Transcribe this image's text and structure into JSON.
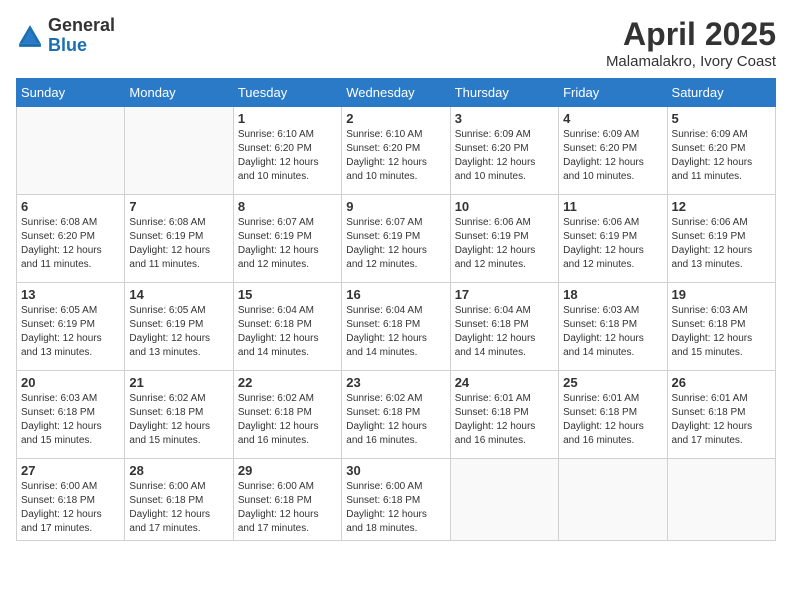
{
  "header": {
    "logo_general": "General",
    "logo_blue": "Blue",
    "month_title": "April 2025",
    "location": "Malamalakro, Ivory Coast"
  },
  "weekdays": [
    "Sunday",
    "Monday",
    "Tuesday",
    "Wednesday",
    "Thursday",
    "Friday",
    "Saturday"
  ],
  "weeks": [
    [
      {
        "day": "",
        "detail": ""
      },
      {
        "day": "",
        "detail": ""
      },
      {
        "day": "1",
        "detail": "Sunrise: 6:10 AM\nSunset: 6:20 PM\nDaylight: 12 hours and 10 minutes."
      },
      {
        "day": "2",
        "detail": "Sunrise: 6:10 AM\nSunset: 6:20 PM\nDaylight: 12 hours and 10 minutes."
      },
      {
        "day": "3",
        "detail": "Sunrise: 6:09 AM\nSunset: 6:20 PM\nDaylight: 12 hours and 10 minutes."
      },
      {
        "day": "4",
        "detail": "Sunrise: 6:09 AM\nSunset: 6:20 PM\nDaylight: 12 hours and 10 minutes."
      },
      {
        "day": "5",
        "detail": "Sunrise: 6:09 AM\nSunset: 6:20 PM\nDaylight: 12 hours and 11 minutes."
      }
    ],
    [
      {
        "day": "6",
        "detail": "Sunrise: 6:08 AM\nSunset: 6:20 PM\nDaylight: 12 hours and 11 minutes."
      },
      {
        "day": "7",
        "detail": "Sunrise: 6:08 AM\nSunset: 6:19 PM\nDaylight: 12 hours and 11 minutes."
      },
      {
        "day": "8",
        "detail": "Sunrise: 6:07 AM\nSunset: 6:19 PM\nDaylight: 12 hours and 12 minutes."
      },
      {
        "day": "9",
        "detail": "Sunrise: 6:07 AM\nSunset: 6:19 PM\nDaylight: 12 hours and 12 minutes."
      },
      {
        "day": "10",
        "detail": "Sunrise: 6:06 AM\nSunset: 6:19 PM\nDaylight: 12 hours and 12 minutes."
      },
      {
        "day": "11",
        "detail": "Sunrise: 6:06 AM\nSunset: 6:19 PM\nDaylight: 12 hours and 12 minutes."
      },
      {
        "day": "12",
        "detail": "Sunrise: 6:06 AM\nSunset: 6:19 PM\nDaylight: 12 hours and 13 minutes."
      }
    ],
    [
      {
        "day": "13",
        "detail": "Sunrise: 6:05 AM\nSunset: 6:19 PM\nDaylight: 12 hours and 13 minutes."
      },
      {
        "day": "14",
        "detail": "Sunrise: 6:05 AM\nSunset: 6:19 PM\nDaylight: 12 hours and 13 minutes."
      },
      {
        "day": "15",
        "detail": "Sunrise: 6:04 AM\nSunset: 6:18 PM\nDaylight: 12 hours and 14 minutes."
      },
      {
        "day": "16",
        "detail": "Sunrise: 6:04 AM\nSunset: 6:18 PM\nDaylight: 12 hours and 14 minutes."
      },
      {
        "day": "17",
        "detail": "Sunrise: 6:04 AM\nSunset: 6:18 PM\nDaylight: 12 hours and 14 minutes."
      },
      {
        "day": "18",
        "detail": "Sunrise: 6:03 AM\nSunset: 6:18 PM\nDaylight: 12 hours and 14 minutes."
      },
      {
        "day": "19",
        "detail": "Sunrise: 6:03 AM\nSunset: 6:18 PM\nDaylight: 12 hours and 15 minutes."
      }
    ],
    [
      {
        "day": "20",
        "detail": "Sunrise: 6:03 AM\nSunset: 6:18 PM\nDaylight: 12 hours and 15 minutes."
      },
      {
        "day": "21",
        "detail": "Sunrise: 6:02 AM\nSunset: 6:18 PM\nDaylight: 12 hours and 15 minutes."
      },
      {
        "day": "22",
        "detail": "Sunrise: 6:02 AM\nSunset: 6:18 PM\nDaylight: 12 hours and 16 minutes."
      },
      {
        "day": "23",
        "detail": "Sunrise: 6:02 AM\nSunset: 6:18 PM\nDaylight: 12 hours and 16 minutes."
      },
      {
        "day": "24",
        "detail": "Sunrise: 6:01 AM\nSunset: 6:18 PM\nDaylight: 12 hours and 16 minutes."
      },
      {
        "day": "25",
        "detail": "Sunrise: 6:01 AM\nSunset: 6:18 PM\nDaylight: 12 hours and 16 minutes."
      },
      {
        "day": "26",
        "detail": "Sunrise: 6:01 AM\nSunset: 6:18 PM\nDaylight: 12 hours and 17 minutes."
      }
    ],
    [
      {
        "day": "27",
        "detail": "Sunrise: 6:00 AM\nSunset: 6:18 PM\nDaylight: 12 hours and 17 minutes."
      },
      {
        "day": "28",
        "detail": "Sunrise: 6:00 AM\nSunset: 6:18 PM\nDaylight: 12 hours and 17 minutes."
      },
      {
        "day": "29",
        "detail": "Sunrise: 6:00 AM\nSunset: 6:18 PM\nDaylight: 12 hours and 17 minutes."
      },
      {
        "day": "30",
        "detail": "Sunrise: 6:00 AM\nSunset: 6:18 PM\nDaylight: 12 hours and 18 minutes."
      },
      {
        "day": "",
        "detail": ""
      },
      {
        "day": "",
        "detail": ""
      },
      {
        "day": "",
        "detail": ""
      }
    ]
  ]
}
